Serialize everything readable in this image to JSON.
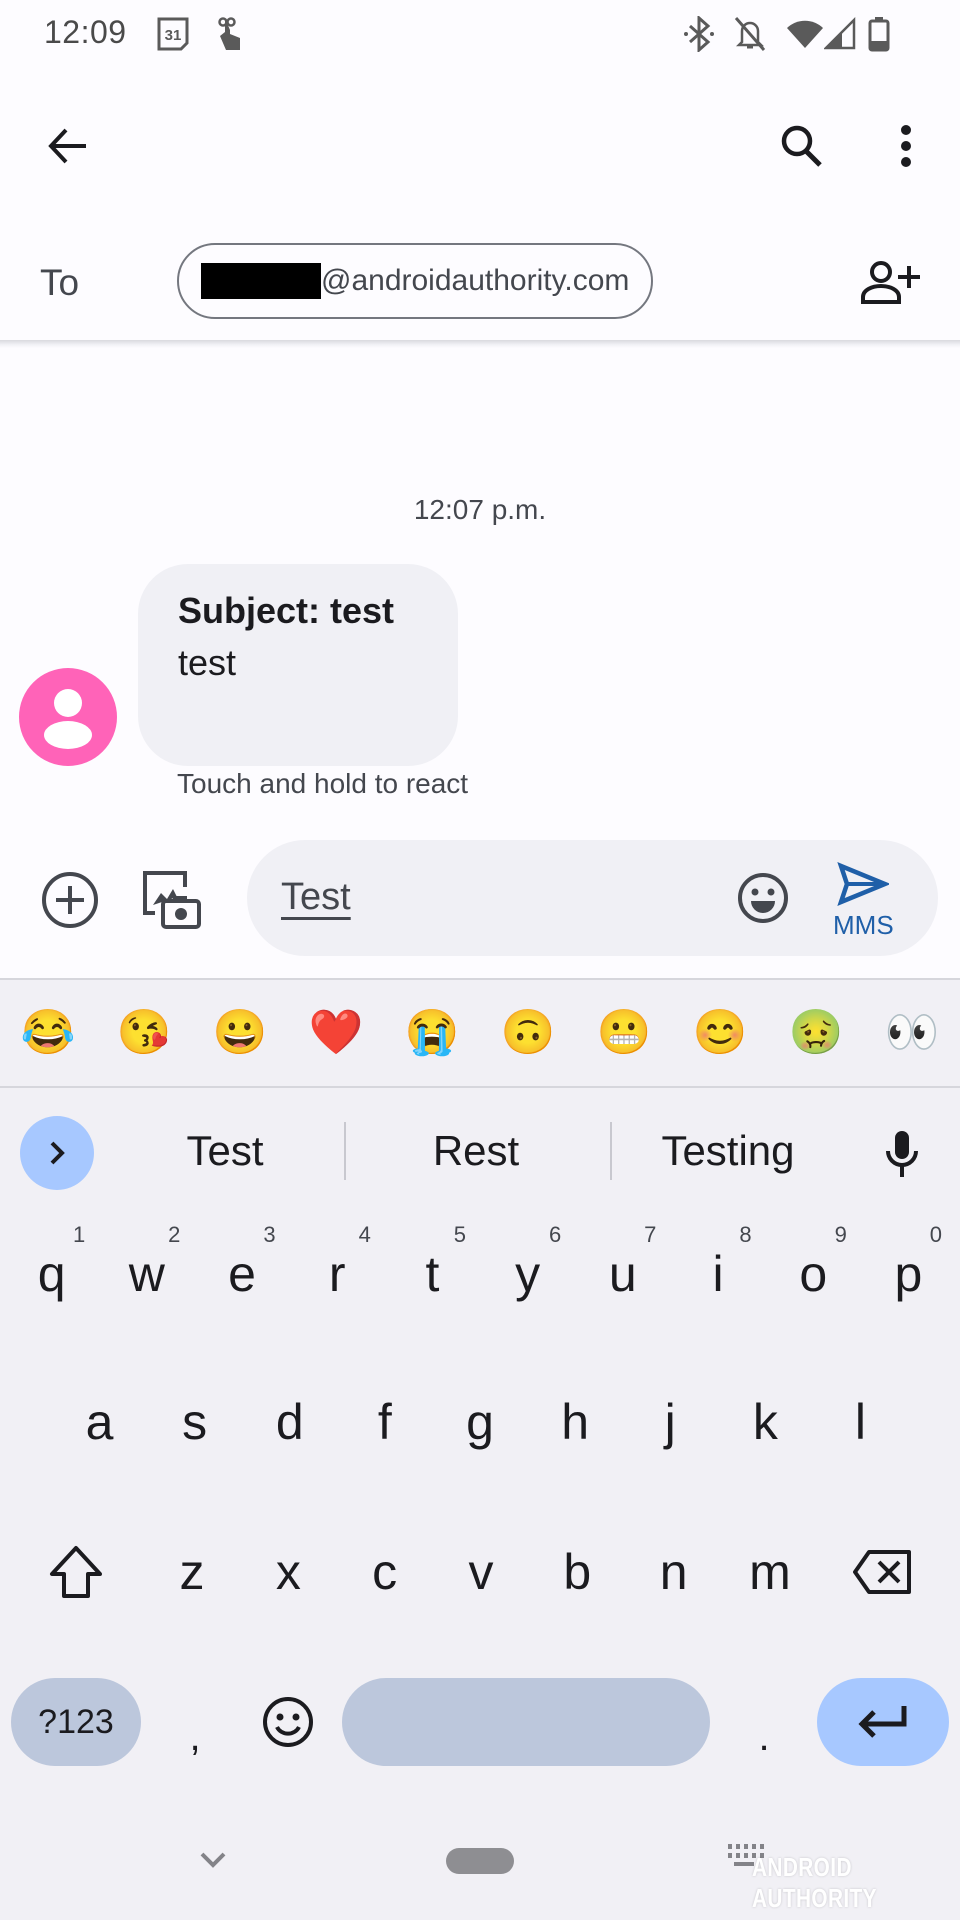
{
  "status_bar": {
    "time": "12:09",
    "left_icons": [
      "calendar-icon",
      "touch-gesture-icon"
    ],
    "calendar_day": "31",
    "right_icons": [
      "bluetooth-icon",
      "notifications-off-icon",
      "wifi-icon",
      "cellular-signal-icon",
      "battery-icon"
    ]
  },
  "toolbar": {
    "back_icon": "arrow-back-icon",
    "search_icon": "search-icon",
    "more_icon": "more-vert-icon"
  },
  "recipient": {
    "to_label": "To",
    "chip_text": "@androidauthority.com",
    "chip_redacted": true,
    "add_contact_icon": "person-add-icon"
  },
  "conversation": {
    "timestamp": "12:07 p.m.",
    "messages": [
      {
        "subject": "Subject: test",
        "body": "test",
        "avatar_color": "#ff63b8"
      }
    ],
    "react_hint": "Touch and hold to react"
  },
  "compose": {
    "text": "Test",
    "send_label": "MMS",
    "accent_color": "#1f5fa8"
  },
  "keyboard": {
    "emoji_row": [
      "😂",
      "😘",
      "😀",
      "❤️",
      "😭",
      "🙃",
      "😬",
      "😊",
      "🤢",
      "👀"
    ],
    "suggestions": [
      "Test",
      "Rest",
      "Testing"
    ],
    "row1": [
      "q",
      "w",
      "e",
      "r",
      "t",
      "y",
      "u",
      "i",
      "o",
      "p"
    ],
    "row1_hints": [
      "1",
      "2",
      "3",
      "4",
      "5",
      "6",
      "7",
      "8",
      "9",
      "0"
    ],
    "row2": [
      "a",
      "s",
      "d",
      "f",
      "g",
      "h",
      "j",
      "k",
      "l"
    ],
    "row3": [
      "z",
      "x",
      "c",
      "v",
      "b",
      "n",
      "m"
    ],
    "symbols_key": "?123",
    "comma_key": ",",
    "period_key": "."
  },
  "watermark": "ANDROID AUTHORITY"
}
